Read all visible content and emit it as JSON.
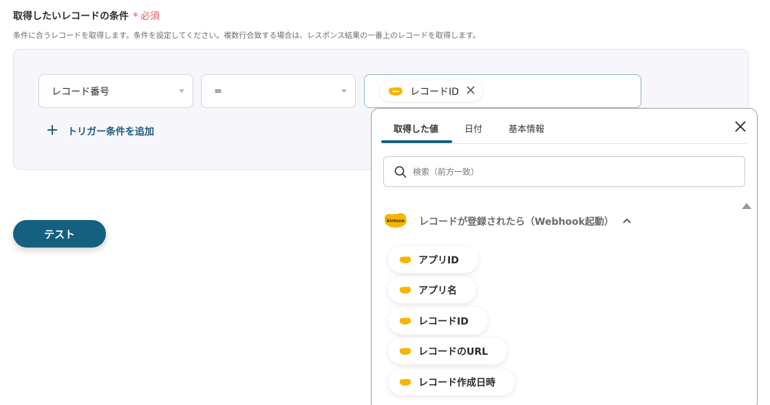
{
  "section": {
    "title": "取得したいレコードの条件",
    "required_star": "*",
    "required_label": "必須",
    "description": "条件に合うレコードを取得します。条件を設定してください。複数行合致する場合は、レスポンス結果の一番上のレコードを取得します。"
  },
  "condition": {
    "field_value": "レコード番号",
    "operator_value": "=",
    "value_chip": "レコードID",
    "add_trigger": "トリガー条件を追加"
  },
  "test_button": "テスト",
  "popup": {
    "tabs": [
      {
        "label": "取得した値",
        "active": true
      },
      {
        "label": "日付",
        "active": false
      },
      {
        "label": "基本情報",
        "active": false
      }
    ],
    "search_placeholder": "検索（前方一致）",
    "group_label": "レコードが登録されたら（Webhook起動）",
    "items": [
      {
        "label": "アプリID"
      },
      {
        "label": "アプリ名"
      },
      {
        "label": "レコードID"
      },
      {
        "label": "レコードのURL"
      },
      {
        "label": "レコード作成日時"
      }
    ],
    "logo_text": "kintone"
  },
  "colors": {
    "accent": "#15607f",
    "required": "#e8585f",
    "kintone_yellow": "#f7b500"
  }
}
